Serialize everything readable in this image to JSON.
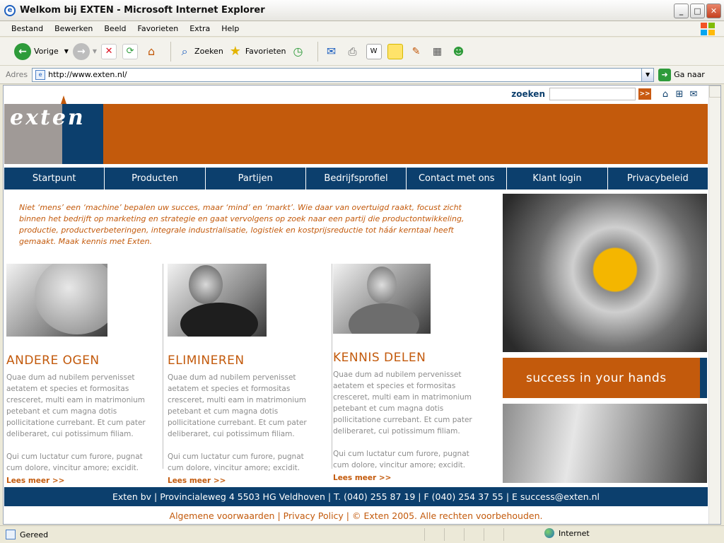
{
  "window": {
    "title": "Welkom bij EXTEN - Microsoft Internet Explorer"
  },
  "menu": [
    "Bestand",
    "Bewerken",
    "Beeld",
    "Favorieten",
    "Extra",
    "Help"
  ],
  "toolbar": {
    "back": "Vorige",
    "search": "Zoeken",
    "favorites": "Favorieten"
  },
  "address": {
    "label": "Adres",
    "url": "http://www.exten.nl/",
    "go": "Ga naar"
  },
  "site": {
    "search_label": "zoeken",
    "search_go": ">>",
    "logo_text": "exten",
    "nav": [
      "Startpunt",
      "Producten",
      "Partijen",
      "Bedrijfsprofiel",
      "Contact met ons",
      "Klant login",
      "Privacybeleid"
    ],
    "intro": "Niet ‘mens’ een ‘machine’ bepalen uw succes, maar ‘mind’ en ‘markt’. Wie daar van overtuigd raakt, focust zicht binnen het bedrijft op marketing en strategie en gaat vervolgens op zoek naar een partij die productontwikkeling, productie, productverbeteringen, integrale industrialisatie, logistiek en kostprijsreductie tot háár kerntaal heeft gemaakt. Maak kennis met Exten.",
    "columns": [
      {
        "title": "ANDERE OGEN",
        "p1": "Quae dum ad nubilem pervenisset aetatem et species et formositas cresceret, multi eam in matrimonium petebant et cum magna dotis pollicitatione currebant. Et cum pater deliberaret, cui potissimum filiam.",
        "p2": "Qui cum luctatur cum furore, pugnat cum dolore, vincitur amore; excidit.",
        "more": "Lees meer >>"
      },
      {
        "title": "ELIMINEREN",
        "p1": "Quae dum ad nubilem pervenisset aetatem et species et formositas cresceret, multi eam in matrimonium petebant et cum magna dotis pollicitatione currebant. Et cum pater deliberaret, cui potissimum filiam.",
        "p2": "Qui cum luctatur cum furore, pugnat cum dolore, vincitur amore; excidit.",
        "more": "Lees meer >>"
      },
      {
        "title": "KENNIS DELEN",
        "p1": "Quae dum ad nubilem pervenisset aetatem et species et formositas cresceret, multi eam in matrimonium petebant et cum magna dotis pollicitatione currebant. Et cum pater deliberaret, cui potissimum filiam.",
        "p2": "Qui cum luctatur cum furore, pugnat cum dolore, vincitur amore; excidit.",
        "more": "Lees meer >>"
      }
    ],
    "slogan": "success in your hands",
    "footer_contact": "Exten bv | Provincialeweg 4 5503 HG Veldhoven | T. (040) 255 87 19 | F (040) 254 37 55 | E success@exten.nl",
    "footer_legal": "Algemene voorwaarden | Privacy Policy | © Exten 2005. Alle rechten voorbehouden."
  },
  "status": {
    "text": "Gereed",
    "zone": "Internet"
  },
  "colors": {
    "brand_orange": "#c35a0c",
    "brand_blue": "#0c3f6d"
  }
}
